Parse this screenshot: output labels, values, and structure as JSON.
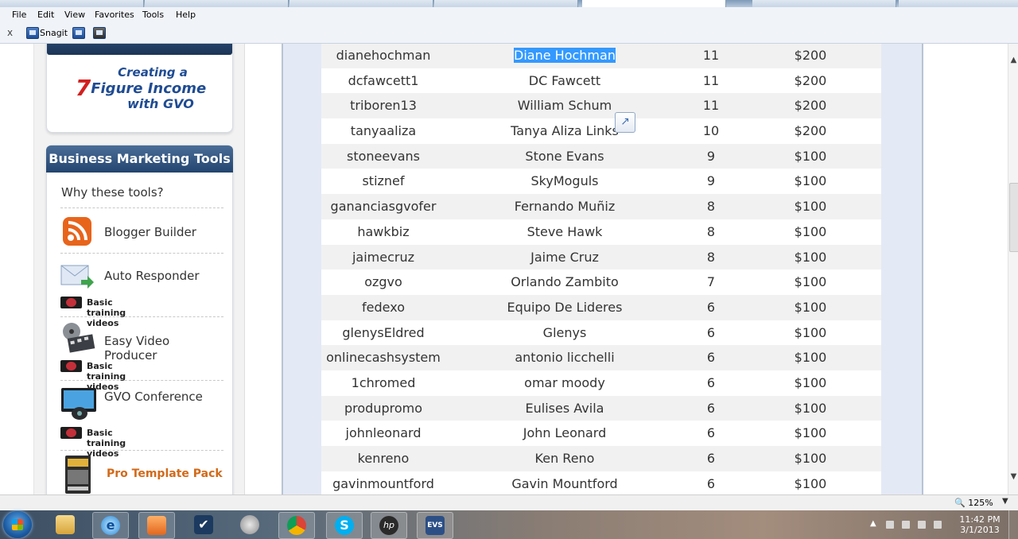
{
  "menu": [
    "File",
    "Edit",
    "View",
    "Favorites",
    "Tools",
    "Help"
  ],
  "toolbar": {
    "close": "x",
    "snagit": "Snagit"
  },
  "logo": {
    "line1": "Creating a",
    "seven": "7",
    "line2": "Figure Income",
    "line3": "with GVO"
  },
  "sidebar": {
    "header": "Business Marketing Tools",
    "intro": "Why these tools?",
    "items": [
      {
        "label": "Blogger Builder",
        "icon": "rss-icon"
      },
      {
        "label": "Auto Responder",
        "icon": "email-arrow-icon",
        "sub": "Basic training videos"
      },
      {
        "label": "Easy Video Producer",
        "icon": "film-reel-icon",
        "sub": "Basic training videos"
      },
      {
        "label": "GVO Conference",
        "icon": "webcam-monitor-icon",
        "sub": "Basic training videos"
      },
      {
        "label": "Pro Template Pack",
        "icon": "template-box-icon"
      }
    ]
  },
  "table": {
    "rows": [
      {
        "user": "dianehochman",
        "name": "Diane Hochman",
        "count": "11",
        "amount": "$200",
        "selected": true
      },
      {
        "user": "dcfawcett1",
        "name": "DC Fawcett",
        "count": "11",
        "amount": "$200"
      },
      {
        "user": "triboren13",
        "name": "William Schum",
        "count": "11",
        "amount": "$200"
      },
      {
        "user": "tanyaaliza",
        "name": "Tanya Aliza Links",
        "count": "10",
        "amount": "$200"
      },
      {
        "user": "stoneevans",
        "name": "Stone Evans",
        "count": "9",
        "amount": "$100"
      },
      {
        "user": "stiznef",
        "name": "SkyMoguls",
        "count": "9",
        "amount": "$100"
      },
      {
        "user": "gananciasgvofer",
        "name": "Fernando Muñiz",
        "count": "8",
        "amount": "$100"
      },
      {
        "user": "hawkbiz",
        "name": "Steve Hawk",
        "count": "8",
        "amount": "$100"
      },
      {
        "user": "jaimecruz",
        "name": "Jaime Cruz",
        "count": "8",
        "amount": "$100"
      },
      {
        "user": "ozgvo",
        "name": "Orlando Zambito",
        "count": "7",
        "amount": "$100"
      },
      {
        "user": "fedexo",
        "name": "Equipo De Lideres",
        "count": "6",
        "amount": "$100"
      },
      {
        "user": "glenysEldred",
        "name": "Glenys",
        "count": "6",
        "amount": "$100"
      },
      {
        "user": "onlinecashsystem",
        "name": "antonio licchelli",
        "count": "6",
        "amount": "$100"
      },
      {
        "user": "1chromed",
        "name": "omar moody",
        "count": "6",
        "amount": "$100"
      },
      {
        "user": "produpromo",
        "name": "Eulises Avila",
        "count": "6",
        "amount": "$100"
      },
      {
        "user": "johnleonard",
        "name": "John Leonard",
        "count": "6",
        "amount": "$100"
      },
      {
        "user": "kenreno",
        "name": "Ken Reno",
        "count": "6",
        "amount": "$100"
      },
      {
        "user": "gavinmountford",
        "name": "Gavin Mountford",
        "count": "6",
        "amount": "$100"
      }
    ]
  },
  "status": {
    "zoom": "125%"
  },
  "taskbar": {
    "time": "11:42 PM",
    "date": "3/1/2013",
    "apps": [
      "start",
      "file-explorer",
      "internet-explorer",
      "media-player",
      "checkmark-app",
      "network-tool",
      "chrome",
      "skype",
      "hp",
      "evs"
    ],
    "evs_label": "EVS"
  },
  "colors": {
    "selection": "#3399ff",
    "header_blue": "#23456f",
    "odd_row": "#f1f1f1"
  }
}
